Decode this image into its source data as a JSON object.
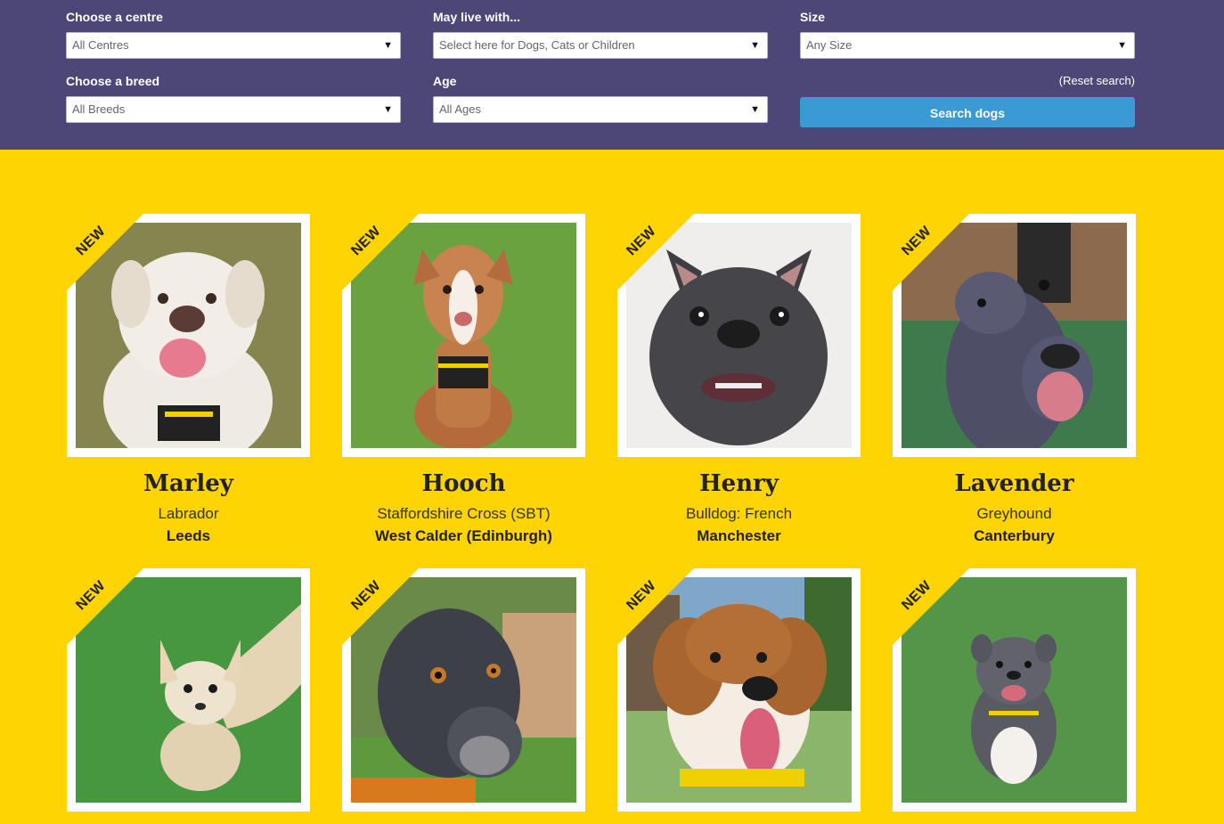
{
  "filters": {
    "centre": {
      "label": "Choose a centre",
      "value": "All Centres"
    },
    "live_with": {
      "label": "May live with...",
      "value": "Select here for Dogs, Cats or Children"
    },
    "size": {
      "label": "Size",
      "value": "Any Size"
    },
    "breed": {
      "label": "Choose a breed",
      "value": "All Breeds"
    },
    "age": {
      "label": "Age",
      "value": "All Ages"
    },
    "reset_label": "(Reset search)",
    "search_label": "Search dogs",
    "dropdown_icon": "triangle-down-icon"
  },
  "ribbon_label": "NEW",
  "dogs": [
    {
      "name": "Marley",
      "breed": "Labrador",
      "centre": "Leeds"
    },
    {
      "name": "Hooch",
      "breed": "Staffordshire Cross (SBT)",
      "centre": "West Calder (Edinburgh)"
    },
    {
      "name": "Henry",
      "breed": "Bulldog: French",
      "centre": "Manchester"
    },
    {
      "name": "Lavender",
      "breed": "Greyhound",
      "centre": "Canterbury"
    },
    {
      "name": "",
      "breed": "",
      "centre": ""
    },
    {
      "name": "",
      "breed": "",
      "centre": ""
    },
    {
      "name": "",
      "breed": "",
      "centre": ""
    },
    {
      "name": "",
      "breed": "",
      "centre": ""
    }
  ],
  "colors": {
    "header_bg": "#4d4778",
    "page_bg": "#ffd400",
    "button": "#3a9ad4"
  }
}
